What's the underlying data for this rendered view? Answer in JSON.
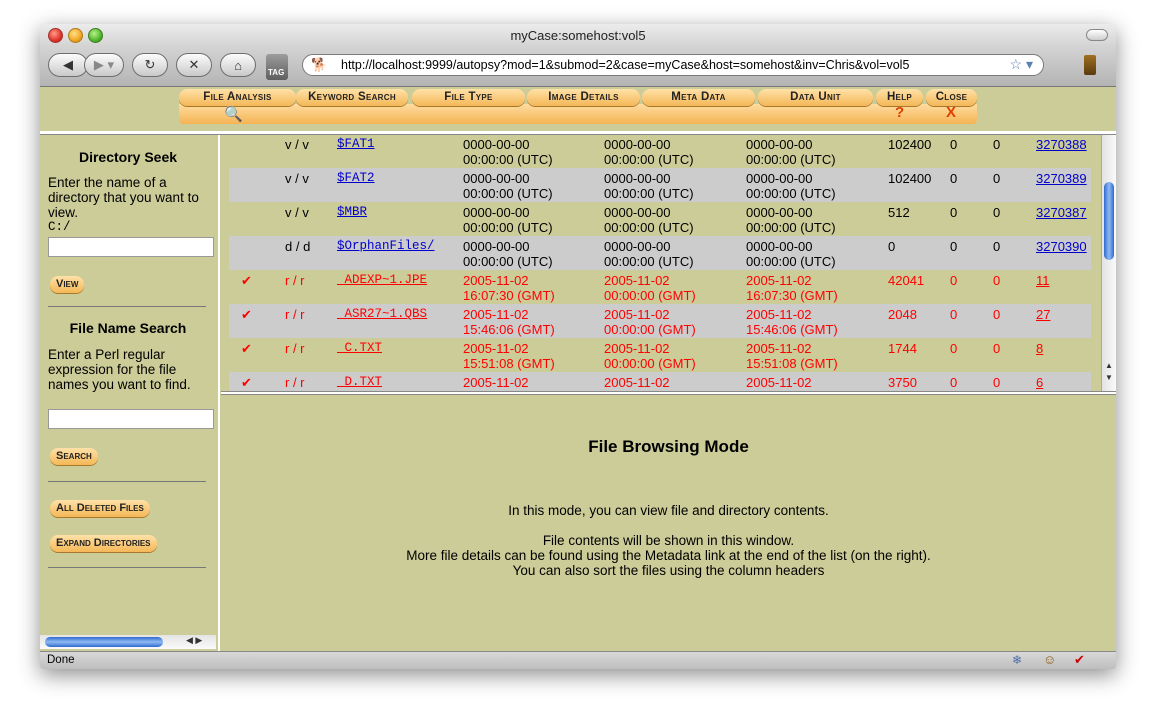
{
  "window": {
    "title": "myCase:somehost:vol5"
  },
  "browser": {
    "url": "http://localhost:9999/autopsy?mod=1&submod=2&case=myCase&host=somehost&inv=Chris&vol=vol5",
    "tag_label": "TAG",
    "status": "Done"
  },
  "menu": {
    "items": [
      {
        "label": "File Analysis",
        "icon": "magnifier-icon"
      },
      {
        "label": "Keyword Search"
      },
      {
        "label": "File Type"
      },
      {
        "label": "Image Details"
      },
      {
        "label": "Meta Data"
      },
      {
        "label": "Data Unit"
      },
      {
        "label": "Help",
        "glyph": "?"
      },
      {
        "label": "Close",
        "glyph": "X"
      }
    ]
  },
  "sidebar": {
    "dir_seek": {
      "title": "Directory Seek",
      "description": "Enter the name of a directory that you want to view.",
      "prefix": "C:/",
      "button": "View"
    },
    "name_search": {
      "title": "File Name Search",
      "description": "Enter a Perl regular expression for the file names you want to find.",
      "button": "Search"
    },
    "all_deleted": "All Deleted Files",
    "expand_dirs": "Expand Directories"
  },
  "files": [
    {
      "deleted": false,
      "type": "v / v",
      "name": "$FAT1",
      "written": [
        "0000-00-00",
        "00:00:00 (UTC)"
      ],
      "accessed": [
        "0000-00-00",
        "00:00:00 (UTC)"
      ],
      "created": [
        "0000-00-00",
        "00:00:00 (UTC)"
      ],
      "size": "102400",
      "uid": "0",
      "gid": "0",
      "meta": "3270388"
    },
    {
      "deleted": false,
      "type": "v / v",
      "name": "$FAT2",
      "written": [
        "0000-00-00",
        "00:00:00 (UTC)"
      ],
      "accessed": [
        "0000-00-00",
        "00:00:00 (UTC)"
      ],
      "created": [
        "0000-00-00",
        "00:00:00 (UTC)"
      ],
      "size": "102400",
      "uid": "0",
      "gid": "0",
      "meta": "3270389"
    },
    {
      "deleted": false,
      "type": "v / v",
      "name": "$MBR",
      "written": [
        "0000-00-00",
        "00:00:00 (UTC)"
      ],
      "accessed": [
        "0000-00-00",
        "00:00:00 (UTC)"
      ],
      "created": [
        "0000-00-00",
        "00:00:00 (UTC)"
      ],
      "size": "512",
      "uid": "0",
      "gid": "0",
      "meta": "3270387"
    },
    {
      "deleted": false,
      "type": "d / d",
      "name": "$OrphanFiles/",
      "written": [
        "0000-00-00",
        "00:00:00 (UTC)"
      ],
      "accessed": [
        "0000-00-00",
        "00:00:00 (UTC)"
      ],
      "created": [
        "0000-00-00",
        "00:00:00 (UTC)"
      ],
      "size": "0",
      "uid": "0",
      "gid": "0",
      "meta": "3270390"
    },
    {
      "deleted": true,
      "type": "r / r",
      "name": "_ADEXP~1.JPE",
      "written": [
        "2005-11-02",
        "16:07:30 (GMT)"
      ],
      "accessed": [
        "2005-11-02",
        "00:00:00 (GMT)"
      ],
      "created": [
        "2005-11-02",
        "16:07:30 (GMT)"
      ],
      "size": "42041",
      "uid": "0",
      "gid": "0",
      "meta": "11"
    },
    {
      "deleted": true,
      "type": "r / r",
      "name": "_ASR27~1.QBS",
      "written": [
        "2005-11-02",
        "15:46:06 (GMT)"
      ],
      "accessed": [
        "2005-11-02",
        "00:00:00 (GMT)"
      ],
      "created": [
        "2005-11-02",
        "15:46:06 (GMT)"
      ],
      "size": "2048",
      "uid": "0",
      "gid": "0",
      "meta": "27"
    },
    {
      "deleted": true,
      "type": "r / r",
      "name": "_C.TXT",
      "written": [
        "2005-11-02",
        "15:51:08 (GMT)"
      ],
      "accessed": [
        "2005-11-02",
        "00:00:00 (GMT)"
      ],
      "created": [
        "2005-11-02",
        "15:51:08 (GMT)"
      ],
      "size": "1744",
      "uid": "0",
      "gid": "0",
      "meta": "8"
    },
    {
      "deleted": true,
      "type": "r / r",
      "name": "_D.TXT",
      "written": [
        "2005-11-02",
        ""
      ],
      "accessed": [
        "2005-11-02",
        ""
      ],
      "created": [
        "2005-11-02",
        ""
      ],
      "size": "3750",
      "uid": "0",
      "gid": "0",
      "meta": "6"
    }
  ],
  "mode_panel": {
    "title": "File Browsing Mode",
    "line1": "In this mode, you can view file and directory contents.",
    "line2": "File contents will be shown in this window.",
    "line3": "More file details can be found using the Metadata link at the end of the list (on the right).",
    "line4": "You can also sort the files using the column headers"
  },
  "colors": {
    "panel": "#cccc99",
    "alt_row": "#cccccc",
    "deleted": "#ff0000",
    "link": "#0000cc",
    "button": "#f4b757"
  }
}
